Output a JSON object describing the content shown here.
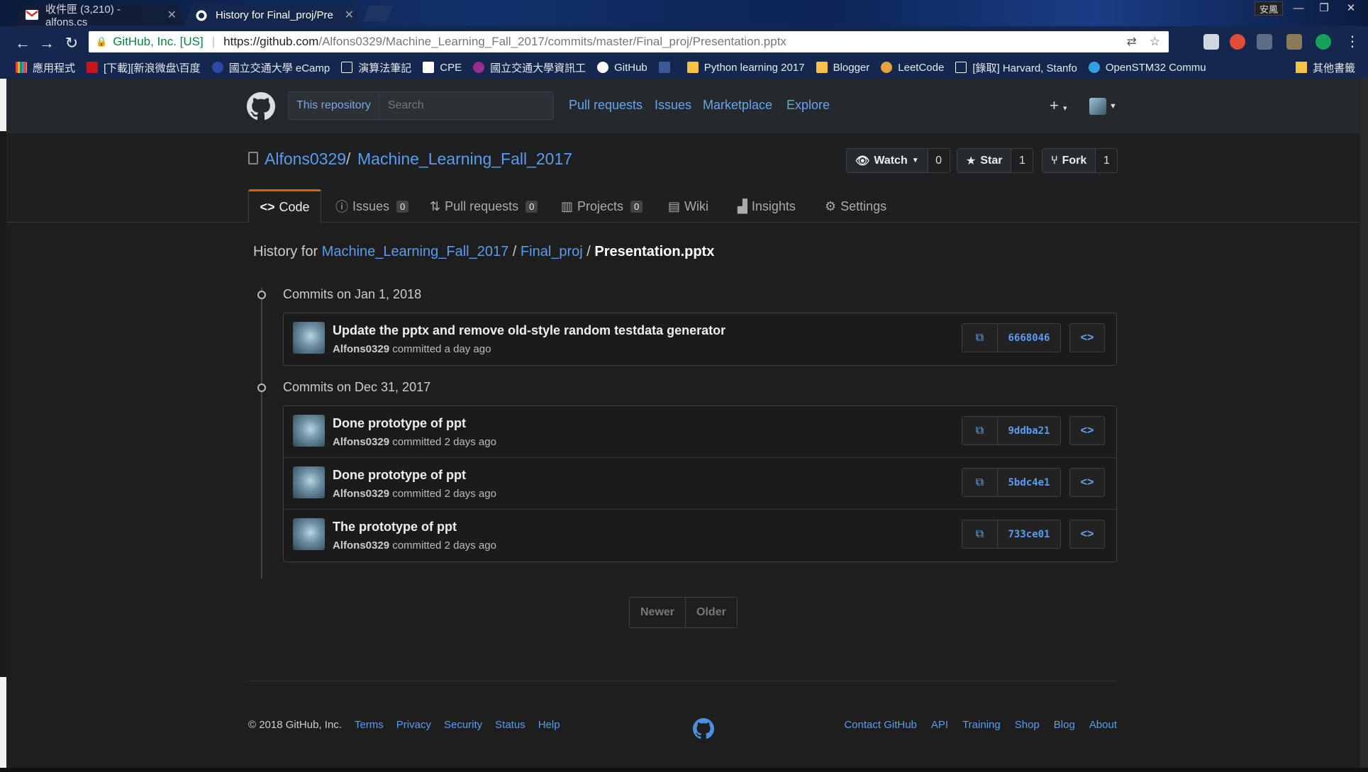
{
  "browser": {
    "tabs": [
      {
        "title": "收件匣 (3,210) - alfons.cs",
        "active": false,
        "icon": "gmail-icon"
      },
      {
        "title": "History for Final_proj/Pre",
        "active": true,
        "icon": "github-icon"
      }
    ],
    "user_badge": "安鳳",
    "omnibox": {
      "secure_label": "GitHub, Inc. [US]",
      "url_host": "https://github.com",
      "url_path": "/Alfons0329/Machine_Learning_Fall_2017/commits/master/Final_proj/Presentation.pptx"
    },
    "bookmarks": [
      {
        "label": "應用程式",
        "icon": "apps-grid-icon",
        "color": "#e8453c"
      },
      {
        "label": "[下載][新浪微盘\\百度",
        "icon": "bookmark-red-icon",
        "color": "#c4161c"
      },
      {
        "label": "國立交通大學 eCamp",
        "icon": "globe-icon",
        "color": "#2b4aa5"
      },
      {
        "label": "演算法筆記",
        "icon": "page-icon",
        "color": "#ffffff"
      },
      {
        "label": "CPE",
        "icon": "dj-icon",
        "color": "#ffffff"
      },
      {
        "label": "國立交通大學資訊工",
        "icon": "nctu-icon",
        "color": "#9b2d8f"
      },
      {
        "label": "GitHub",
        "icon": "github-icon",
        "color": "#ffffff"
      },
      {
        "label": "",
        "icon": "facebook-icon",
        "color": "#3b5998"
      },
      {
        "label": "Python learning 2017",
        "icon": "folder-icon",
        "color": "#f6c243"
      },
      {
        "label": "Blogger",
        "icon": "folder-icon",
        "color": "#f6c243"
      },
      {
        "label": "LeetCode",
        "icon": "leetcode-icon",
        "color": "#e6a23c"
      },
      {
        "label": "[錄取] Harvard, Stanfo",
        "icon": "page-icon",
        "color": "#ffffff"
      },
      {
        "label": "OpenSTM32 Commu",
        "icon": "openstm-icon",
        "color": "#35a0e0"
      }
    ],
    "other_bookmarks": "其他書籤"
  },
  "gh_header": {
    "scope_label": "This repository",
    "search_placeholder": "Search",
    "nav": [
      "Pull requests",
      "Issues",
      "Marketplace",
      "Explore"
    ]
  },
  "repo": {
    "owner": "Alfons0329",
    "name": "Machine_Learning_Fall_2017",
    "watch_label": "Watch",
    "watch_count": "0",
    "star_label": "Star",
    "star_count": "1",
    "fork_label": "Fork",
    "fork_count": "1",
    "tabs": {
      "code": "Code",
      "issues": "Issues",
      "issues_count": "0",
      "pulls": "Pull requests",
      "pulls_count": "0",
      "projects": "Projects",
      "projects_count": "0",
      "wiki": "Wiki",
      "insights": "Insights",
      "settings": "Settings"
    }
  },
  "history": {
    "prefix": "History for",
    "repo_link": "Machine_Learning_Fall_2017",
    "dir_link": "Final_proj",
    "file": "Presentation.pptx",
    "groups": [
      {
        "title": "Commits on Jan 1, 2018",
        "commits": [
          {
            "message": "Update the pptx and remove old-style random testdata generator",
            "author": "Alfons0329",
            "when": "committed a day ago",
            "sha": "6668046"
          }
        ]
      },
      {
        "title": "Commits on Dec 31, 2017",
        "commits": [
          {
            "message": "Done prototype of ppt",
            "author": "Alfons0329",
            "when": "committed 2 days ago",
            "sha": "9ddba21"
          },
          {
            "message": "Done prototype of ppt",
            "author": "Alfons0329",
            "when": "committed 2 days ago",
            "sha": "5bdc4e1"
          },
          {
            "message": "The prototype of ppt",
            "author": "Alfons0329",
            "when": "committed 2 days ago",
            "sha": "733ce01"
          }
        ]
      }
    ],
    "pagination": {
      "newer": "Newer",
      "older": "Older"
    }
  },
  "footer": {
    "copyright": "© 2018 GitHub, Inc.",
    "left_links": [
      "Terms",
      "Privacy",
      "Security",
      "Status",
      "Help"
    ],
    "right_links": [
      "Contact GitHub",
      "API",
      "Training",
      "Shop",
      "Blog",
      "About"
    ]
  },
  "colors": {
    "link": "#5b9bf0",
    "header_bg": "#24292e",
    "page_bg": "#1e1e1e",
    "tab_accent": "#e36209"
  }
}
